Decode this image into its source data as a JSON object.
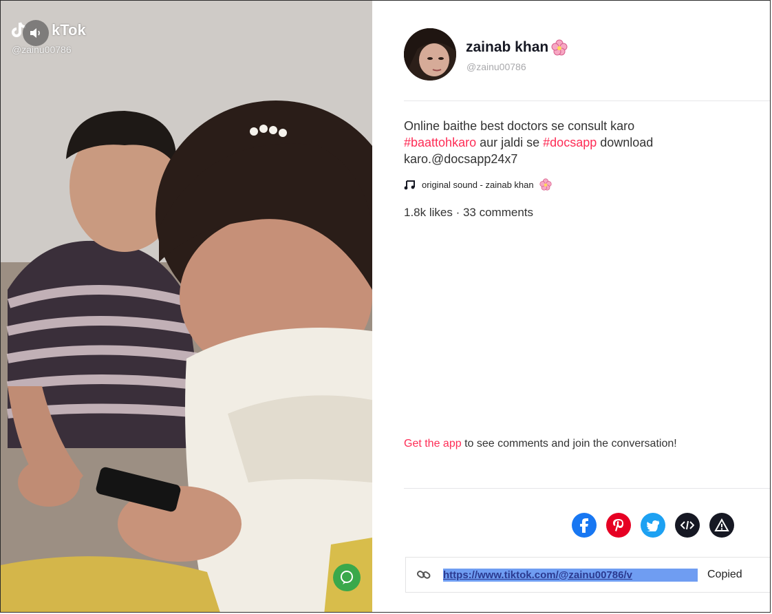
{
  "watermark": {
    "logo_text": "kTok",
    "handle": "@zainu00786"
  },
  "profile": {
    "name": "zainab khan",
    "handle": "@zainu00786"
  },
  "caption": {
    "text1": "Online baithe best doctors se consult karo",
    "tag1": "#baattohkaro",
    "text2": " aur jaldi se ",
    "tag2": "#docsapp",
    "text3": " download karo.@docsapp24x7"
  },
  "sound": {
    "label": "original sound - zainab khan"
  },
  "stats": {
    "text": "1.8k likes · 33 comments"
  },
  "cta": {
    "link": "Get the app",
    "rest": " to see comments and join the conversation!"
  },
  "share": {
    "icons": [
      "facebook-icon",
      "pinterest-icon",
      "twitter-icon",
      "embed-icon",
      "report-icon"
    ],
    "colors": {
      "facebook": "#1877f2",
      "pinterest": "#e60023",
      "twitter": "#1da1f2",
      "embed": "#161823",
      "report": "#161823"
    }
  },
  "link_bar": {
    "url": "https://www.tiktok.com/@zainu00786/v",
    "copied_label": "Copied"
  },
  "accent_color": "#fe2c55"
}
